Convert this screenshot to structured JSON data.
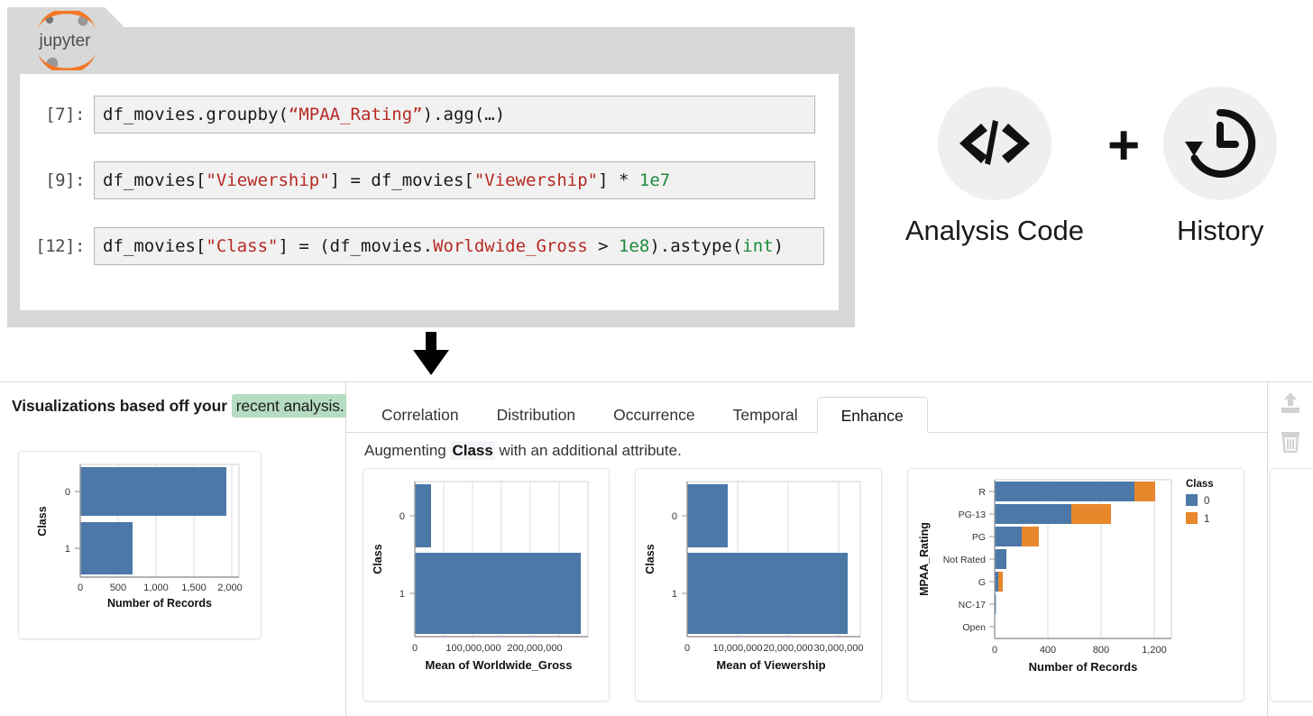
{
  "notebook": {
    "logo_alt": "jupyter",
    "logo_text": "jupyter",
    "cells": [
      {
        "prompt": "[7]:",
        "segments": [
          {
            "t": "df_movies.groupby(",
            "c": "plain"
          },
          {
            "t": "“MPAA_Rating”",
            "c": "str"
          },
          {
            "t": ").agg(…)",
            "c": "plain"
          }
        ]
      },
      {
        "prompt": "[9]:",
        "segments": [
          {
            "t": "df_movies[",
            "c": "plain"
          },
          {
            "t": "\"Viewership\"",
            "c": "str"
          },
          {
            "t": "] = df_movies[",
            "c": "plain"
          },
          {
            "t": "\"Viewership\"",
            "c": "str"
          },
          {
            "t": "] * ",
            "c": "plain"
          },
          {
            "t": "1e7",
            "c": "num"
          }
        ]
      },
      {
        "prompt": "[12]:",
        "segments": [
          {
            "t": "df_movies[",
            "c": "plain"
          },
          {
            "t": "\"Class\"",
            "c": "str"
          },
          {
            "t": "] = (df_movies.",
            "c": "plain"
          },
          {
            "t": "Worldwide_Gross",
            "c": "attr"
          },
          {
            "t": " > ",
            "c": "plain"
          },
          {
            "t": "1e8",
            "c": "num"
          },
          {
            "t": ").astype(",
            "c": "plain"
          },
          {
            "t": "int",
            "c": "fn"
          },
          {
            "t": ")",
            "c": "plain"
          }
        ]
      }
    ]
  },
  "legend_icons": {
    "code": {
      "icon": "code-brackets-icon",
      "label": "Analysis Code"
    },
    "plus": "+",
    "history": {
      "icon": "clock-history-icon",
      "label": "History"
    }
  },
  "sidebar": {
    "title_prefix": "Visualizations based off your ",
    "title_highlight": "recent analysis.",
    "chart_index": 0
  },
  "main": {
    "tabs": [
      {
        "label": "Correlation",
        "active": false
      },
      {
        "label": "Distribution",
        "active": false
      },
      {
        "label": "Occurrence",
        "active": false
      },
      {
        "label": "Temporal",
        "active": false
      },
      {
        "label": "Enhance",
        "active": true
      }
    ],
    "subtitle_pre": "Augmenting ",
    "subtitle_attr": "Class",
    "subtitle_post": " with an additional attribute."
  },
  "rail": {
    "items": [
      {
        "name": "upload-icon",
        "state": "disabled"
      },
      {
        "name": "trash-icon",
        "state": "disabled"
      },
      {
        "name": "info-icon",
        "state": "enabled"
      },
      {
        "name": "edit-icon",
        "state": "enabled"
      },
      {
        "name": "warning-icon",
        "state": "enabled"
      }
    ]
  },
  "colors": {
    "blue": "#4c78a8",
    "orange": "#e8872b",
    "green_highlight": "#b6dcc2",
    "notebook_gray": "#d8d8d8",
    "code_red": "#b52a24",
    "code_green": "#1e8a3c",
    "jupyter_orange": "#f37726"
  },
  "chart_data": [
    {
      "id": "sidebar-class-count",
      "type": "bar",
      "orientation": "horizontal",
      "categories": [
        "0",
        "1"
      ],
      "values": [
        1930,
        690
      ],
      "title": "",
      "xlabel": "Number of Records",
      "ylabel": "Class",
      "xticks": [
        0,
        500,
        1000,
        1500,
        2000
      ],
      "xticklabels": [
        "0",
        "500",
        "1,000",
        "1,500",
        "2,000"
      ],
      "xlim": [
        0,
        2100
      ],
      "grid": true,
      "color": "#4c78a8"
    },
    {
      "id": "mean-worldwide-gross",
      "type": "bar",
      "orientation": "horizontal",
      "categories": [
        "0",
        "1"
      ],
      "values": [
        22000000,
        268000000
      ],
      "title": "",
      "xlabel": "Mean of Worldwide_Gross",
      "ylabel": "Class",
      "xticks": [
        0,
        100000000,
        200000000
      ],
      "xticklabels": [
        "0",
        "100,000,000",
        "200,000,000"
      ],
      "xlim": [
        0,
        290000000
      ],
      "grid": true,
      "color": "#4c78a8"
    },
    {
      "id": "mean-viewership",
      "type": "bar",
      "orientation": "horizontal",
      "categories": [
        "0",
        "1"
      ],
      "values": [
        8000000,
        31500000
      ],
      "title": "",
      "xlabel": "Mean of Viewership",
      "ylabel": "Class",
      "xticks": [
        0,
        10000000,
        20000000,
        30000000
      ],
      "xticklabels": [
        "0",
        "10,000,000",
        "20,000,000",
        "30,000,000"
      ],
      "xlim": [
        0,
        34000000
      ],
      "grid": true,
      "color": "#4c78a8"
    },
    {
      "id": "mpaa-rating-by-class",
      "type": "bar",
      "orientation": "horizontal",
      "stacked": true,
      "categories": [
        "R",
        "PG-13",
        "PG",
        "Not Rated",
        "G",
        "NC-17",
        "Open"
      ],
      "series": [
        {
          "name": "0",
          "color": "#4c78a8",
          "values": [
            1050,
            575,
            205,
            90,
            25,
            4,
            0
          ]
        },
        {
          "name": "1",
          "color": "#e8872b",
          "values": [
            155,
            300,
            130,
            0,
            35,
            0,
            0
          ]
        }
      ],
      "title": "",
      "xlabel": "Number of Records",
      "ylabel": "MPAA_Rating",
      "xticks": [
        0,
        400,
        800,
        1200
      ],
      "xticklabels": [
        "0",
        "400",
        "800",
        "1,200"
      ],
      "xlim": [
        0,
        1330
      ],
      "grid": true,
      "legend": {
        "title": "Class",
        "position": "right",
        "entries": [
          "0",
          "1"
        ]
      }
    }
  ]
}
